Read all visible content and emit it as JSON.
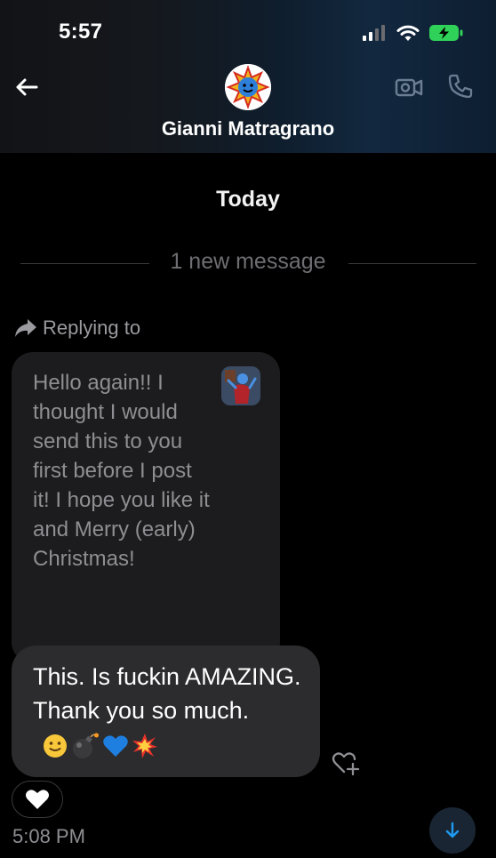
{
  "status_bar": {
    "time": "5:57",
    "icons": [
      "cellular-signal-icon",
      "wifi-icon",
      "battery-charging-icon"
    ]
  },
  "header": {
    "contact_name": "Gianni Matragrano",
    "back_icon": "arrow-left-icon",
    "video_icon": "video-camera-icon",
    "call_icon": "phone-icon"
  },
  "conversation": {
    "date_label": "Today",
    "new_message_divider": "1 new message",
    "replying_to_label": "Replying to",
    "quoted_message": {
      "text": "Hello again!! I thought I would send this to you first before I post it! I hope you like it and Merry (early) Christmas!"
    },
    "reply_message": {
      "text": "This. Is fuckin AMAZING. Thank you so much.",
      "emojis": [
        "slightly-smiling-face",
        "bomb",
        "blue-heart",
        "collision"
      ]
    },
    "reaction": "white-heart",
    "timestamp": "5:08 PM"
  },
  "colors": {
    "background": "#000000",
    "sent_bubble": "#2c2c2e",
    "quoted_bubble": "#1c1c1e",
    "accent_blue": "#1d9bf0",
    "battery_green": "#30d158"
  }
}
